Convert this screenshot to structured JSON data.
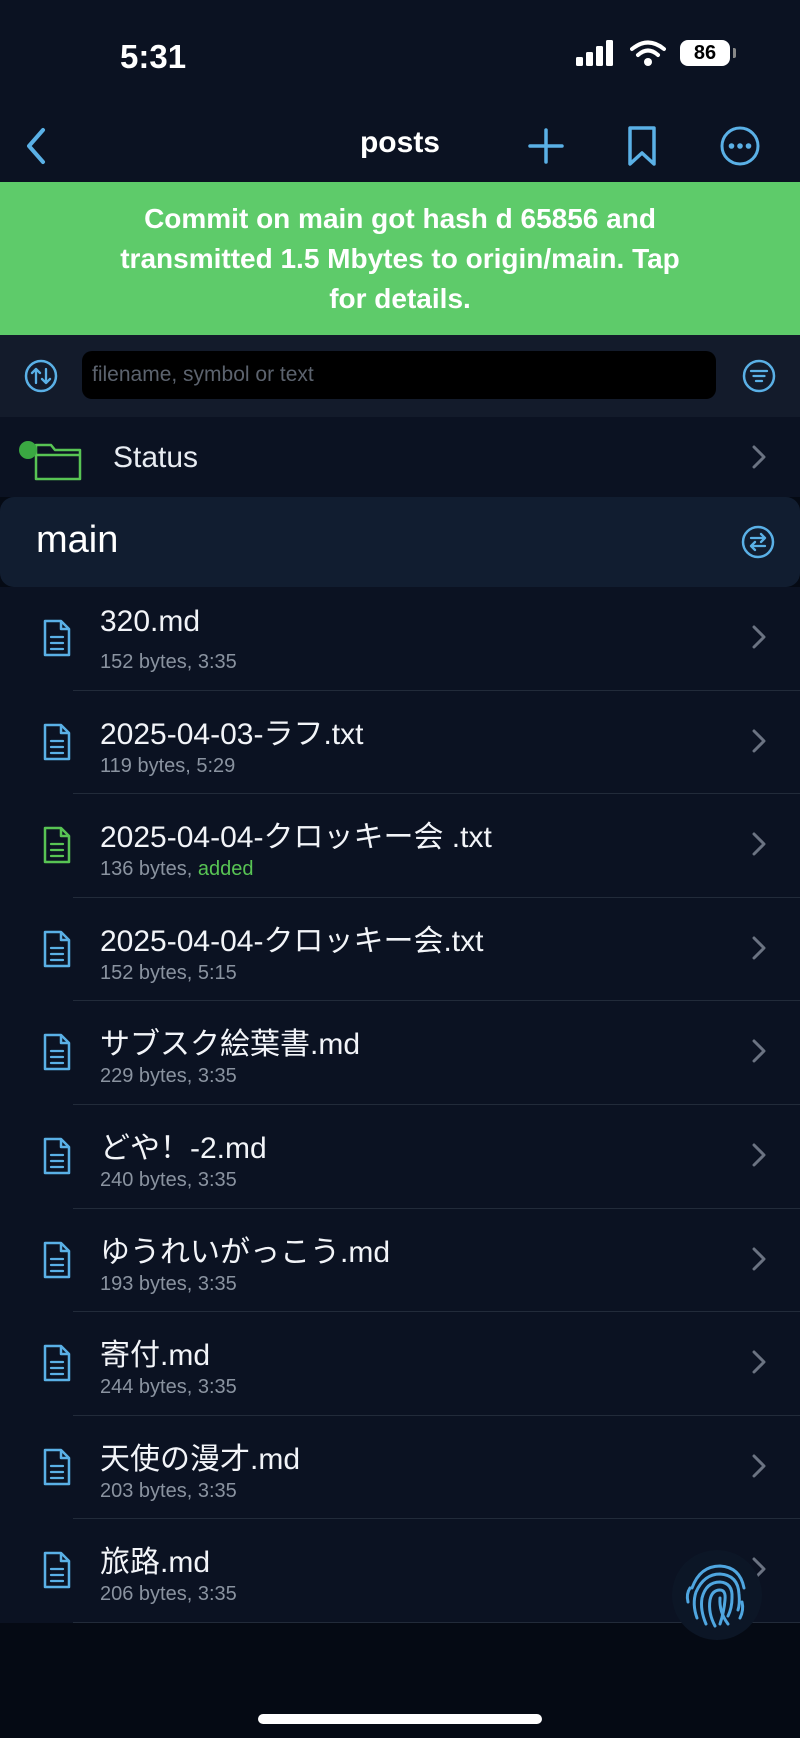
{
  "status_bar": {
    "time": "5:31",
    "battery": "86"
  },
  "nav": {
    "title": "posts",
    "back_icon": "chevron-left-icon",
    "add_icon": "plus-icon",
    "bookmark_icon": "bookmark-icon",
    "more_icon": "ellipsis-circle-icon"
  },
  "banner": {
    "text": "Commit on main got hash d 65856 and transmitted 1.5 Mbytes to origin/main. Tap for details."
  },
  "search": {
    "placeholder": "filename, symbol or text"
  },
  "status_row": {
    "label": "Status"
  },
  "branch": {
    "label": "main"
  },
  "files": [
    {
      "name": "320.md",
      "size": "152 bytes, ",
      "time": "3:35",
      "status": "",
      "icon_color": "#5ab0e6"
    },
    {
      "name": "2025-04-03-ラフ.txt",
      "size": "119 bytes, ",
      "time": "5:29",
      "status": "",
      "icon_color": "#5ab0e6"
    },
    {
      "name": "2025-04-04-クロッキー会 .txt",
      "size": "136 bytes, ",
      "time": "",
      "status": "added",
      "icon_color": "#58c454"
    },
    {
      "name": "2025-04-04-クロッキー会.txt",
      "size": "152 bytes, ",
      "time": "5:15",
      "status": "",
      "icon_color": "#5ab0e6"
    },
    {
      "name": "サブスク絵葉書.md",
      "size": "229 bytes, ",
      "time": "3:35",
      "status": "",
      "icon_color": "#5ab0e6"
    },
    {
      "name": "どや！-2.md",
      "size": "240 bytes, ",
      "time": "3:35",
      "status": "",
      "icon_color": "#5ab0e6"
    },
    {
      "name": "ゆうれいがっこう.md",
      "size": "193 bytes, ",
      "time": "3:35",
      "status": "",
      "icon_color": "#5ab0e6"
    },
    {
      "name": "寄付.md",
      "size": "244 bytes, ",
      "time": "3:35",
      "status": "",
      "icon_color": "#5ab0e6"
    },
    {
      "name": "天使の漫才.md",
      "size": "203 bytes, ",
      "time": "3:35",
      "status": "",
      "icon_color": "#5ab0e6"
    },
    {
      "name": "旅路.md",
      "size": "206 bytes, ",
      "time": "3:35",
      "status": "",
      "icon_color": "#5ab0e6"
    }
  ],
  "colors": {
    "accent": "#5ab0e6",
    "banner": "#5ecb6a",
    "added": "#58c454"
  }
}
